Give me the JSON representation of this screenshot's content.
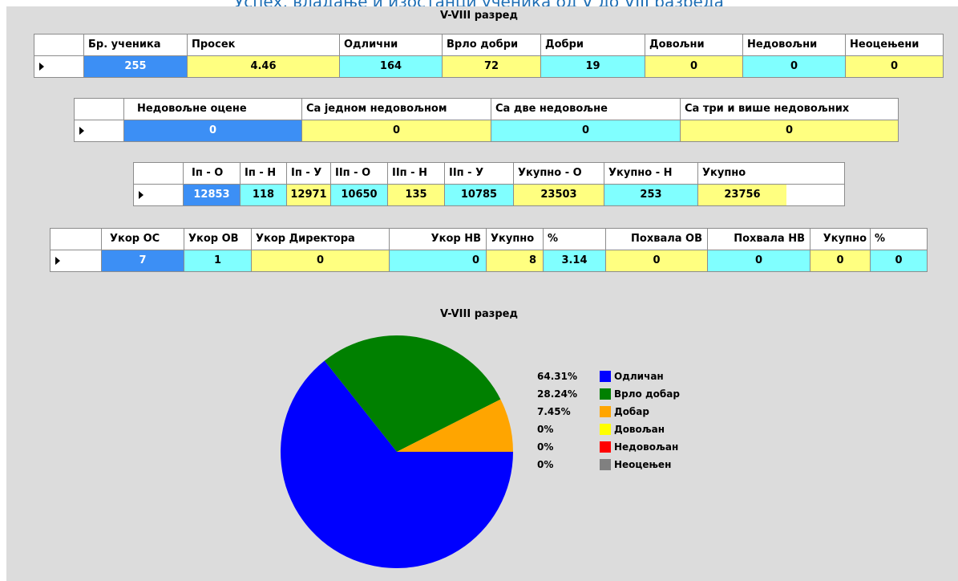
{
  "window": {
    "title": "Успех, владање и изостанци ученика од V до VIII разреда",
    "section_title": "V-VIII разред"
  },
  "grade_table": {
    "columns": [
      "Бр. ученика",
      "Просек",
      "Одлични",
      "Врло добри",
      "Добри",
      "Довољни",
      "Недовољни",
      "Неоцењени"
    ],
    "values": [
      "255",
      "4.46",
      "164",
      "72",
      "19",
      "0",
      "0",
      "0"
    ]
  },
  "fail_table": {
    "columns": [
      "Недовољне оцене",
      "Са једном недовољном",
      "Са две недовољне",
      "Са три и више недовољних"
    ],
    "values": [
      "0",
      "0",
      "0",
      "0"
    ]
  },
  "absence_table": {
    "columns": [
      "Iп - О",
      "Iп - Н",
      "Iп - У",
      "IIп - О",
      "IIп - Н",
      "IIп - У",
      "Укупно - О",
      "Укупно - Н",
      "Укупно"
    ],
    "values": [
      "12853",
      "118",
      "12971",
      "10650",
      "135",
      "10785",
      "23503",
      "253",
      "23756"
    ]
  },
  "discipline_table": {
    "columns": [
      "Укор ОС",
      "Укор ОВ",
      "Укор Директора",
      "Укор НВ",
      "Укупно",
      "%",
      "Похвала ОВ",
      "Похвала НВ",
      "Укупно",
      "%"
    ],
    "values": [
      "7",
      "1",
      "0",
      "0",
      "8",
      "3.14",
      "0",
      "0",
      "0",
      "0"
    ]
  },
  "colors": {
    "blue_cell": "#3c8ff5",
    "yellow_cell": "#ffff80",
    "cyan_cell": "#80ffff",
    "panel_bg": "#dcdcdc"
  },
  "chart_data": {
    "type": "pie",
    "title": "V-VIII разред",
    "legend_position": "right",
    "slices": [
      {
        "label": "Одличан",
        "value": 164,
        "percent_label": "64.31%",
        "color": "#0000ff"
      },
      {
        "label": "Врло добар",
        "value": 72,
        "percent_label": "28.24%",
        "color": "#008000"
      },
      {
        "label": "Добар",
        "value": 19,
        "percent_label": "7.45%",
        "color": "#ffa500"
      },
      {
        "label": "Довољан",
        "value": 0,
        "percent_label": "0%",
        "color": "#ffff00"
      },
      {
        "label": "Недовољан",
        "value": 0,
        "percent_label": "0%",
        "color": "#ff0000"
      },
      {
        "label": "Неоцењен",
        "value": 0,
        "percent_label": "0%",
        "color": "#808080"
      }
    ]
  }
}
